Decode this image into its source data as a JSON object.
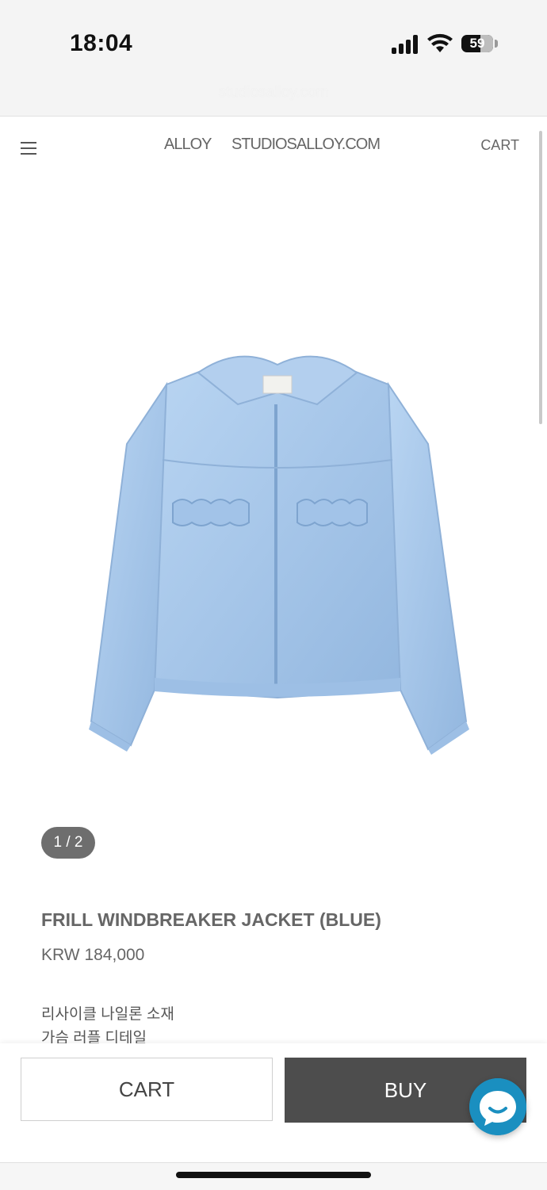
{
  "status_bar": {
    "time": "18:04",
    "battery": "59",
    "url": "studiosalloy.com"
  },
  "header": {
    "nav_links": [
      "ALLOY",
      "STUDIOSALLOY.COM"
    ],
    "cart_label": "CART"
  },
  "product": {
    "image_counter": "1 / 2",
    "name": "FRILL WINDBREAKER JACKET (BLUE)",
    "price": "KRW 184,000",
    "description": [
      "리사이클 나일론 소재",
      "가슴 러플 디테일"
    ],
    "color": "#a8c8ea"
  },
  "actions": {
    "cart_label": "CART",
    "buy_label": "BUY"
  },
  "colors": {
    "accent": "#1a8fc0",
    "buy_bg": "#4d4d4d"
  }
}
